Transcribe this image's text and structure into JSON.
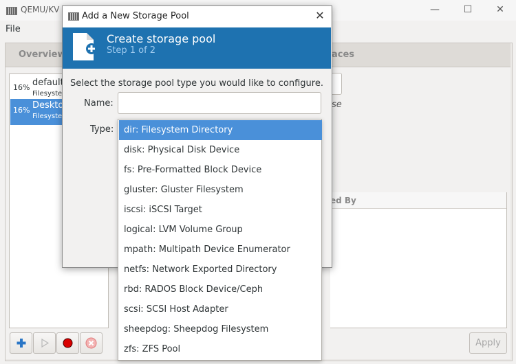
{
  "main": {
    "title": "QEMU/KV",
    "menu_file": "File",
    "tab_overview": "Overview",
    "tab_interfaces": "aces",
    "pools": [
      {
        "pct": "16%",
        "name": "default",
        "type": "Filesyste"
      },
      {
        "pct": "16%",
        "name": "Deskto",
        "type": "Filesyste"
      }
    ],
    "details_italic": "se",
    "volumes_header": "ed By",
    "apply_label": "Apply",
    "icons": [
      "add-pool-icon",
      "start-pool-icon",
      "stop-pool-icon",
      "delete-pool-icon"
    ],
    "colors": {
      "accent": "#4a90d9",
      "header_blue": "#1e72b0",
      "stop_red": "#d90000"
    }
  },
  "dialog": {
    "title": "Add a New Storage Pool",
    "close_glyph": "✕",
    "heading": "Create storage pool",
    "step": "Step 1 of 2",
    "instructions": "Select the storage pool type you would like to configure.",
    "name_label": "Name:",
    "name_value": "",
    "type_label": "Type:",
    "type_options": [
      "dir: Filesystem Directory",
      "disk: Physical Disk Device",
      "fs: Pre-Formatted Block Device",
      "gluster: Gluster Filesystem",
      "iscsi: iSCSI Target",
      "logical: LVM Volume Group",
      "mpath: Multipath Device Enumerator",
      "netfs: Network Exported Directory",
      "rbd: RADOS Block Device/Ceph",
      "scsi: SCSI Host Adapter",
      "sheepdog: Sheepdog Filesystem",
      "zfs: ZFS Pool"
    ],
    "selected_index": 0
  }
}
